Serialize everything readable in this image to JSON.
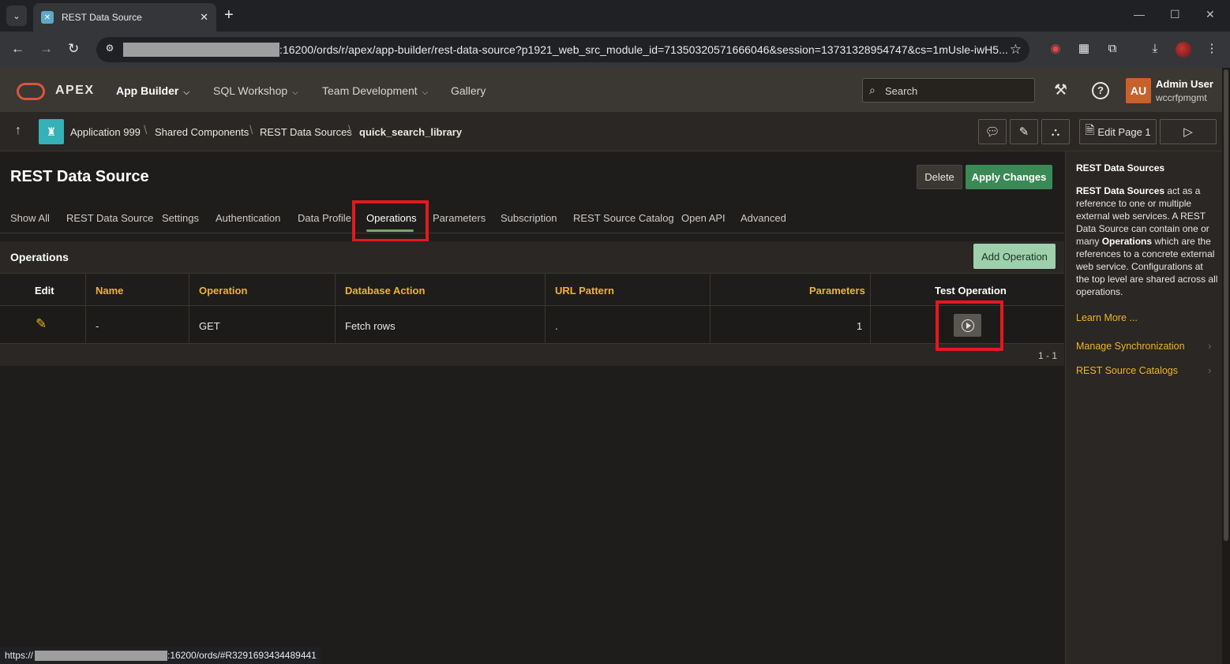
{
  "browser": {
    "tab_title": "REST Data Source",
    "url_visible": ":16200/ords/r/apex/app-builder/rest-data-source?p1921_web_src_module_id=71350320571666046&session=13731328954747&cs=1mUsle-iwH5...",
    "status_url_prefix": "https://",
    "status_url_suffix": ":16200/ords/#R3291693434489441"
  },
  "apex_header": {
    "logo": "APEX",
    "nav": [
      "App Builder",
      "SQL Workshop",
      "Team Development",
      "Gallery"
    ],
    "search_placeholder": "Search",
    "avatar_initials": "AU",
    "user_name": "Admin User",
    "user_workspace": "wccrfpmgmt"
  },
  "breadcrumb": {
    "items": [
      "Application 999",
      "Shared Components",
      "REST Data Sources",
      "quick_search_library"
    ],
    "edit_page_label": "Edit Page 1"
  },
  "page": {
    "title": "REST Data Source",
    "delete_label": "Delete",
    "apply_label": "Apply Changes",
    "tabs": [
      "Show All",
      "REST Data Source",
      "Settings",
      "Authentication",
      "Data Profile",
      "Operations",
      "Parameters",
      "Subscription",
      "REST Source Catalog",
      "Open API",
      "Advanced"
    ],
    "active_tab": "Operations"
  },
  "operations": {
    "title": "Operations",
    "add_label": "Add Operation",
    "columns": [
      "Edit",
      "Name",
      "Operation",
      "Database Action",
      "URL Pattern",
      "Parameters",
      "Test Operation"
    ],
    "rows": [
      {
        "name": "-",
        "operation": "GET",
        "database_action": "Fetch rows",
        "url_pattern": ".",
        "parameters": "1"
      }
    ],
    "pagination": "1 - 1"
  },
  "help_panel": {
    "title": "REST Data Sources",
    "body_lead": "REST Data Sources",
    "body_1": " act as a reference to one or multiple external web services. A REST Data Source can contain one or many ",
    "body_bold_2": "Operations",
    "body_2": " which are the references to a concrete external web service. Configurations at the top level are shared across all operations.",
    "learn_more": "Learn More ...",
    "links": [
      "Manage Synchronization",
      "REST Source Catalogs"
    ]
  },
  "colors": {
    "accent_green": "#3b8a55",
    "column_header": "#f0b429",
    "highlight": "#e3191f",
    "avatar": "#c8612b"
  }
}
